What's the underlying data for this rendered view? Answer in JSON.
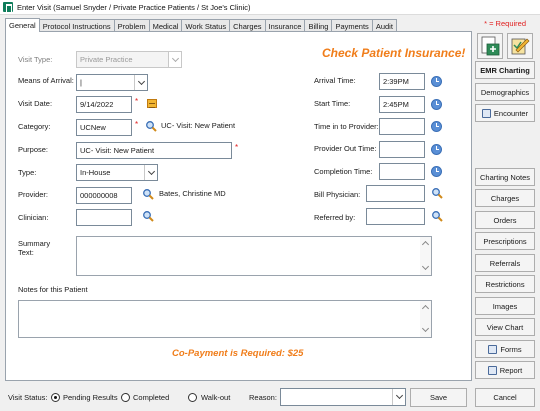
{
  "window": {
    "title": "Enter Visit (Samuel Snyder / Private Practice Patients / St Joe's Clinic)"
  },
  "tabs": [
    "General",
    "Protocol Instructions",
    "Problem",
    "Medical",
    "Work Status",
    "Charges",
    "Insurance",
    "Billing",
    "Payments",
    "Audit"
  ],
  "required_note": "* = Required",
  "banner": {
    "check_insurance": "Check Patient Insurance!",
    "copay": "Co-Payment is Required:  $25"
  },
  "form": {
    "visit_type": {
      "label": "Visit Type:",
      "value": "Private Practice"
    },
    "means_of_arrival": {
      "label": "Means of Arrival:",
      "value": "|"
    },
    "visit_date": {
      "label": "Visit Date:",
      "value": "9/14/2022"
    },
    "category": {
      "label": "Category:",
      "value": "UCNew",
      "description": "UC- Visit: New Patient"
    },
    "purpose": {
      "label": "Purpose:",
      "value": "UC- Visit: New Patient"
    },
    "type": {
      "label": "Type:",
      "value": "In-House"
    },
    "provider": {
      "label": "Provider:",
      "value": "000000008",
      "name": "Bates, Christine  MD"
    },
    "clinician": {
      "label": "Clinician:",
      "value": ""
    },
    "arrival_time": {
      "label": "Arrival Time:",
      "value": "2:39PM"
    },
    "start_time": {
      "label": "Start Time:",
      "value": "2:45PM"
    },
    "time_in_to_provider": {
      "label": "Time in to Provider:",
      "value": ""
    },
    "provider_out_time": {
      "label": "Provider Out Time:",
      "value": ""
    },
    "completion_time": {
      "label": "Completion Time:",
      "value": ""
    },
    "bill_physician": {
      "label": "Bill Physician:",
      "value": ""
    },
    "referred_by": {
      "label": "Referred by:",
      "value": ""
    },
    "summary_text": {
      "label": "Summary Text:",
      "value": ""
    },
    "notes": {
      "label": "Notes for this Patient",
      "value": ""
    }
  },
  "sidebar": {
    "buttons": [
      "EMR Charting",
      "Demographics",
      "Encounter",
      "Charting Notes",
      "Charges",
      "Orders",
      "Prescriptions",
      "Referrals",
      "Restrictions",
      "Images",
      "View Chart",
      "Forms",
      "Report"
    ]
  },
  "bottom": {
    "visit_status_label": "Visit Status:",
    "options": [
      "Pending Results",
      "Completed",
      "Walk-out"
    ],
    "selected": "Pending Results",
    "reason_label": "Reason:",
    "reason_value": "",
    "save": "Save",
    "cancel": "Cancel"
  },
  "icons": [
    "app-icon",
    "magnifier-icon",
    "clock-icon",
    "calendar-icon",
    "chevron-down-icon"
  ]
}
